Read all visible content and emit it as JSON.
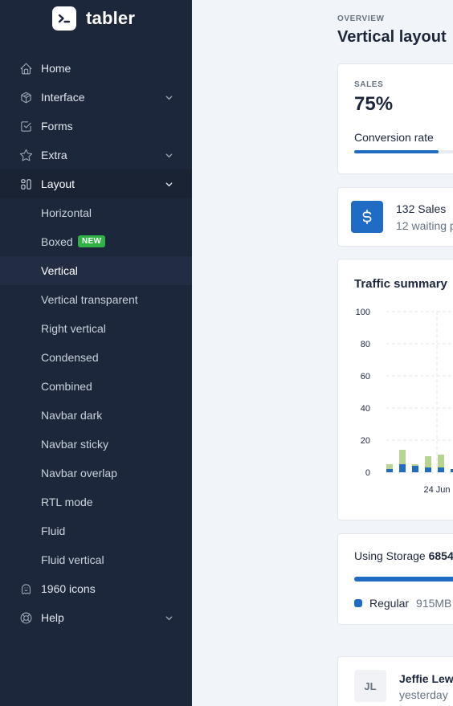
{
  "brand": {
    "name": "tabler"
  },
  "sidebar": {
    "items": [
      {
        "label": "Home",
        "icon": "home-icon"
      },
      {
        "label": "Interface",
        "icon": "package-icon"
      },
      {
        "label": "Forms",
        "icon": "checkbox-icon"
      },
      {
        "label": "Extra",
        "icon": "star-icon"
      },
      {
        "label": "Layout",
        "icon": "layout-icon"
      },
      {
        "label": "1960 icons",
        "icon": "ghost-icon"
      },
      {
        "label": "Help",
        "icon": "lifebuoy-icon"
      }
    ],
    "layout_children": [
      {
        "label": "Horizontal"
      },
      {
        "label": "Boxed",
        "badge": "NEW"
      },
      {
        "label": "Vertical"
      },
      {
        "label": "Vertical transparent"
      },
      {
        "label": "Right vertical"
      },
      {
        "label": "Condensed"
      },
      {
        "label": "Combined"
      },
      {
        "label": "Navbar dark"
      },
      {
        "label": "Navbar sticky"
      },
      {
        "label": "Navbar overlap"
      },
      {
        "label": "RTL mode"
      },
      {
        "label": "Fluid"
      },
      {
        "label": "Fluid vertical"
      }
    ]
  },
  "header": {
    "pretitle": "OVERVIEW",
    "title": "Vertical layout"
  },
  "sales_card": {
    "subheader": "SALES",
    "value": "75%",
    "label": "Conversion rate",
    "progress": 0.75
  },
  "sales_count_card": {
    "title": "132 Sales",
    "subtitle": "12 waiting p"
  },
  "traffic_card": {
    "title": "Traffic summary"
  },
  "chart_data": {
    "type": "bar",
    "title": "Traffic summary",
    "y_ticks": [
      "100",
      "80",
      "60",
      "40",
      "20",
      "0"
    ],
    "x_tick_labels": [
      "24 Jun"
    ],
    "ylim": [
      0,
      100
    ],
    "grid": true,
    "series": [
      {
        "name": "",
        "color": "#206bc4",
        "values": [
          2,
          5,
          4,
          3,
          3,
          2,
          1
        ]
      },
      {
        "name": "",
        "color": "#b7d48f",
        "values": [
          3,
          9,
          1,
          7,
          8,
          0,
          3
        ]
      }
    ]
  },
  "storage_card": {
    "title_prefix": "Using Storage ",
    "amount": "6854",
    "legend_label": "Regular",
    "legend_value": "915MB"
  },
  "user_card": {
    "initials": "JL",
    "name": "Jeffie Lewz",
    "time": "yesterday"
  }
}
